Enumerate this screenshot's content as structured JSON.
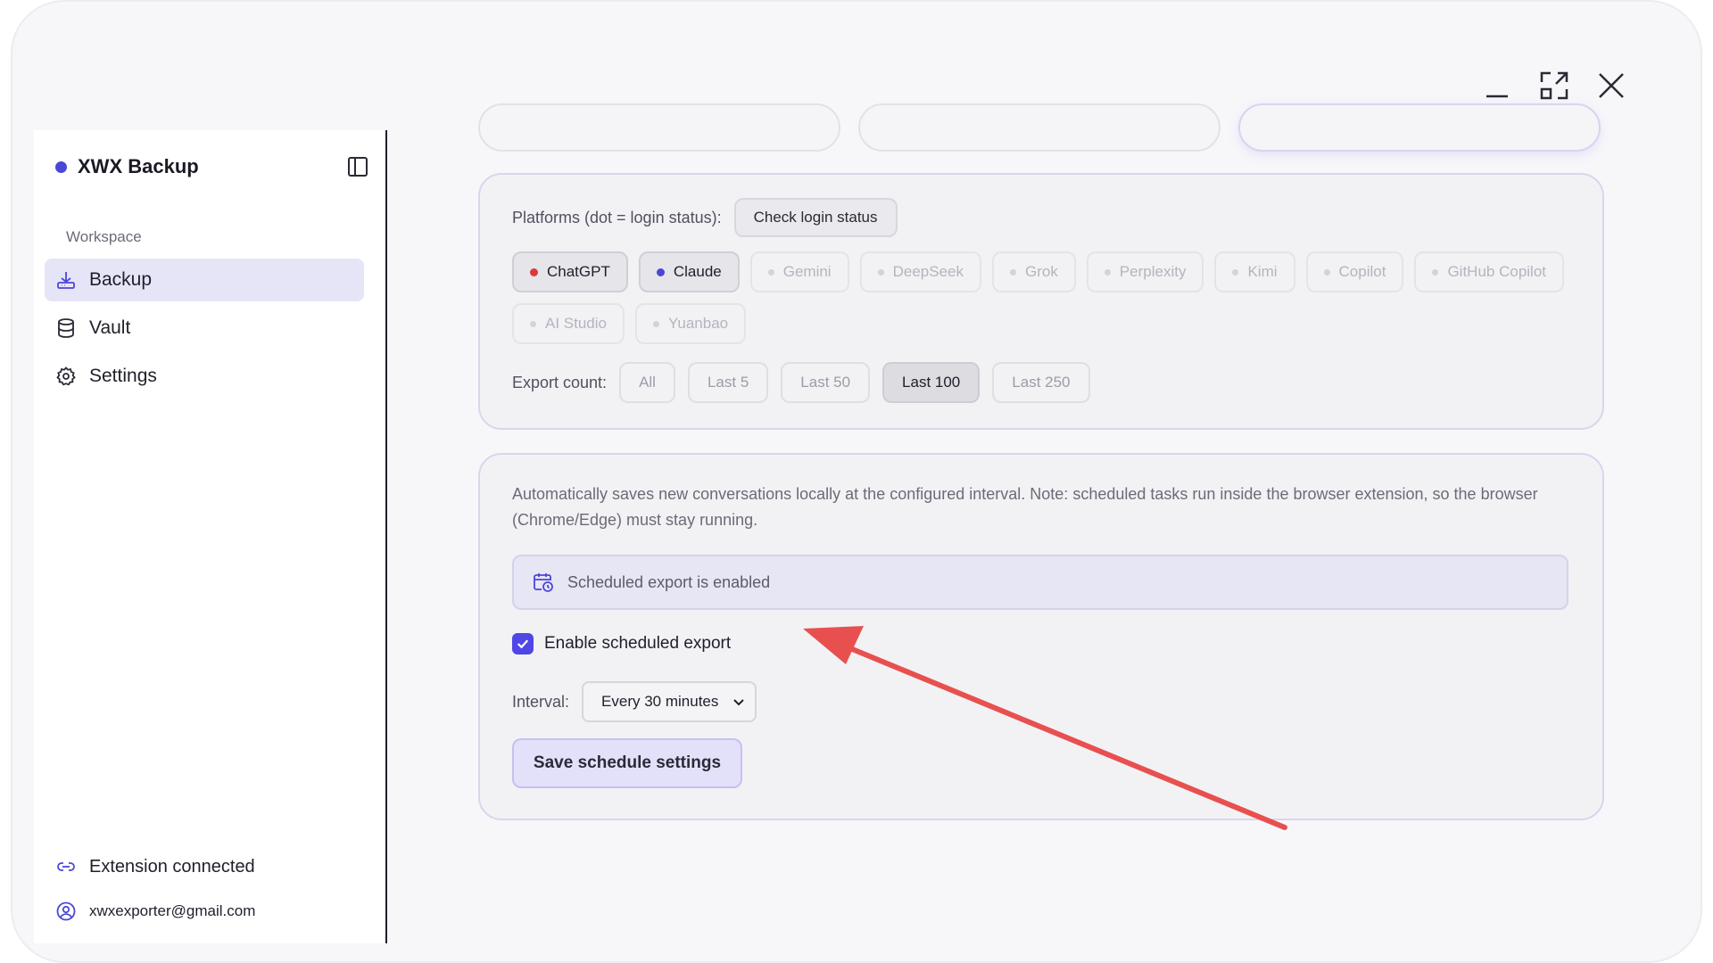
{
  "window": {
    "controls": {
      "minimize": "minimize-icon",
      "maximize": "maximize-icon",
      "close": "close-icon"
    }
  },
  "sidebar": {
    "brand": "XWX Backup",
    "section_label": "Workspace",
    "items": [
      {
        "label": "Backup",
        "icon": "download-tray-icon",
        "active": true
      },
      {
        "label": "Vault",
        "icon": "database-icon",
        "active": false
      },
      {
        "label": "Settings",
        "icon": "gear-icon",
        "active": false
      }
    ],
    "footer": {
      "connection": "Extension connected",
      "email": "xwxexporter@gmail.com"
    }
  },
  "platforms": {
    "label": "Platforms (dot = login status):",
    "check_button": "Check login status",
    "items": [
      {
        "name": "ChatGPT",
        "selected": true,
        "dot": "#d93a3a"
      },
      {
        "name": "Claude",
        "selected": true,
        "dot": "#4b47d6"
      },
      {
        "name": "Gemini",
        "selected": false
      },
      {
        "name": "DeepSeek",
        "selected": false
      },
      {
        "name": "Grok",
        "selected": false
      },
      {
        "name": "Perplexity",
        "selected": false
      },
      {
        "name": "Kimi",
        "selected": false
      },
      {
        "name": "Copilot",
        "selected": false
      },
      {
        "name": "GitHub Copilot",
        "selected": false
      },
      {
        "name": "AI Studio",
        "selected": false
      },
      {
        "name": "Yuanbao",
        "selected": false
      }
    ]
  },
  "export_count": {
    "label": "Export count:",
    "options": [
      "All",
      "Last 5",
      "Last 50",
      "Last 100",
      "Last 250"
    ],
    "selected": "Last 100"
  },
  "schedule": {
    "description": "Automatically saves new conversations locally at the configured interval. Note: scheduled tasks run inside the browser extension, so the browser (Chrome/Edge) must stay running.",
    "status": "Scheduled export is enabled",
    "enable_label": "Enable scheduled export",
    "enabled": true,
    "interval_label": "Interval:",
    "interval_value": "Every 30 minutes",
    "save_button": "Save schedule settings"
  },
  "colors": {
    "accent": "#4f46e5",
    "annotation_arrow": "#e8504f"
  }
}
